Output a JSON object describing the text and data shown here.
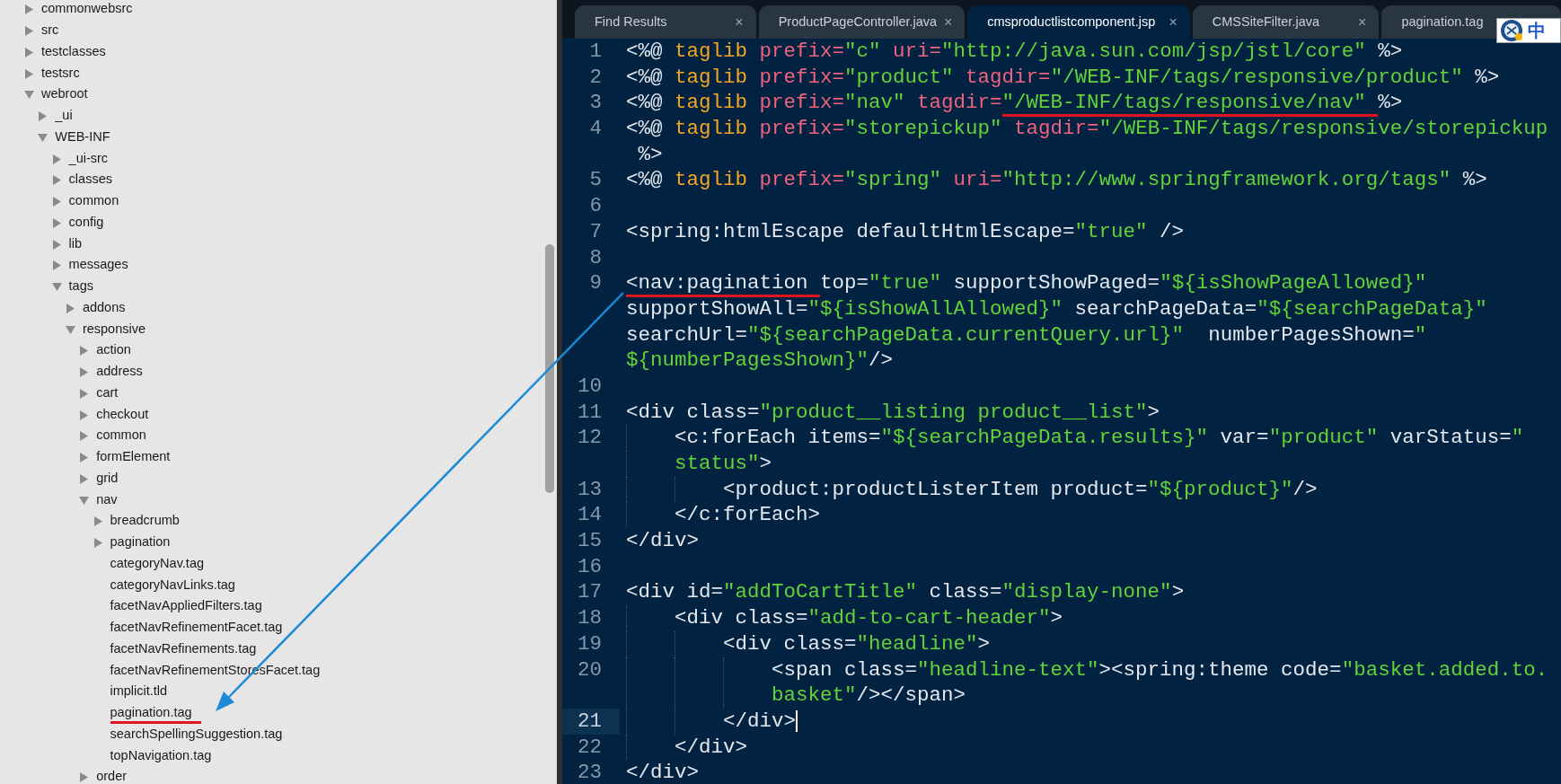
{
  "tree": [
    {
      "label": "commonwebsrc",
      "kind": "folder",
      "expanded": false,
      "underlined": false
    },
    {
      "label": "src",
      "kind": "folder",
      "expanded": false,
      "underlined": false
    },
    {
      "label": "testclasses",
      "kind": "folder",
      "expanded": false,
      "underlined": false
    },
    {
      "label": "testsrc",
      "kind": "folder",
      "expanded": false,
      "underlined": false
    },
    {
      "label": "webroot",
      "kind": "folder",
      "expanded": true,
      "underlined": false,
      "children": [
        {
          "label": "_ui",
          "kind": "folder",
          "expanded": false,
          "underlined": false
        },
        {
          "label": "WEB-INF",
          "kind": "folder",
          "expanded": true,
          "underlined": false,
          "children": [
            {
              "label": "_ui-src",
              "kind": "folder",
              "expanded": false,
              "underlined": false
            },
            {
              "label": "classes",
              "kind": "folder",
              "expanded": false,
              "underlined": false
            },
            {
              "label": "common",
              "kind": "folder",
              "expanded": false,
              "underlined": false
            },
            {
              "label": "config",
              "kind": "folder",
              "expanded": false,
              "underlined": false
            },
            {
              "label": "lib",
              "kind": "folder",
              "expanded": false,
              "underlined": false
            },
            {
              "label": "messages",
              "kind": "folder",
              "expanded": false,
              "underlined": false
            },
            {
              "label": "tags",
              "kind": "folder",
              "expanded": true,
              "underlined": false,
              "children": [
                {
                  "label": "addons",
                  "kind": "folder",
                  "expanded": false,
                  "underlined": false
                },
                {
                  "label": "responsive",
                  "kind": "folder",
                  "expanded": true,
                  "underlined": false,
                  "children": [
                    {
                      "label": "action",
                      "kind": "folder",
                      "expanded": false,
                      "underlined": false
                    },
                    {
                      "label": "address",
                      "kind": "folder",
                      "expanded": false,
                      "underlined": false
                    },
                    {
                      "label": "cart",
                      "kind": "folder",
                      "expanded": false,
                      "underlined": false
                    },
                    {
                      "label": "checkout",
                      "kind": "folder",
                      "expanded": false,
                      "underlined": false
                    },
                    {
                      "label": "common",
                      "kind": "folder",
                      "expanded": false,
                      "underlined": false
                    },
                    {
                      "label": "formElement",
                      "kind": "folder",
                      "expanded": false,
                      "underlined": false
                    },
                    {
                      "label": "grid",
                      "kind": "folder",
                      "expanded": false,
                      "underlined": false
                    },
                    {
                      "label": "nav",
                      "kind": "folder",
                      "expanded": true,
                      "underlined": false,
                      "children": [
                        {
                          "label": "breadcrumb",
                          "kind": "folder",
                          "expanded": false,
                          "underlined": false
                        },
                        {
                          "label": "pagination",
                          "kind": "folder",
                          "expanded": false,
                          "underlined": false
                        },
                        {
                          "label": "categoryNav.tag",
                          "kind": "file",
                          "underlined": false
                        },
                        {
                          "label": "categoryNavLinks.tag",
                          "kind": "file",
                          "underlined": false
                        },
                        {
                          "label": "facetNavAppliedFilters.tag",
                          "kind": "file",
                          "underlined": false
                        },
                        {
                          "label": "facetNavRefinementFacet.tag",
                          "kind": "file",
                          "underlined": false
                        },
                        {
                          "label": "facetNavRefinements.tag",
                          "kind": "file",
                          "underlined": false
                        },
                        {
                          "label": "facetNavRefinementStoresFacet.tag",
                          "kind": "file",
                          "underlined": false
                        },
                        {
                          "label": "implicit.tld",
                          "kind": "file",
                          "underlined": false
                        },
                        {
                          "label": "pagination.tag",
                          "kind": "file",
                          "underlined": true
                        },
                        {
                          "label": "searchSpellingSuggestion.tag",
                          "kind": "file",
                          "underlined": false
                        },
                        {
                          "label": "topNavigation.tag",
                          "kind": "file",
                          "underlined": false
                        }
                      ]
                    },
                    {
                      "label": "order",
                      "kind": "folder",
                      "expanded": false,
                      "underlined": false
                    }
                  ]
                }
              ]
            }
          ]
        }
      ]
    }
  ],
  "tabs": [
    {
      "label": "Find Results",
      "selected": false,
      "close": "×"
    },
    {
      "label": "ProductPageController.java",
      "selected": false,
      "close": "×"
    },
    {
      "label": "cmsproductlistcomponent.jsp",
      "selected": true,
      "close": "×"
    },
    {
      "label": "CMSSiteFilter.java",
      "selected": false,
      "close": "×"
    },
    {
      "label": "pagination.tag",
      "selected": false
    }
  ],
  "ime_indicator": {
    "label": "中"
  },
  "code_lines": [
    {
      "number": "1",
      "current": false,
      "rows": [
        {
          "tokens": [
            {
              "kind": "plain",
              "text": "<%@ ",
              "underlined": false
            },
            {
              "kind": "keyword",
              "text": "taglib",
              "underlined": false
            },
            {
              "kind": "attr",
              "text": " prefix=",
              "underlined": false
            },
            {
              "kind": "string",
              "text": "\"c\"",
              "underlined": false
            },
            {
              "kind": "attr",
              "text": " uri=",
              "underlined": false
            },
            {
              "kind": "string",
              "text": "\"http://java.sun.com/jsp/jstl/core\"",
              "underlined": false
            },
            {
              "kind": "plain",
              "text": " %>",
              "underlined": false
            }
          ]
        }
      ]
    },
    {
      "number": "2",
      "current": false,
      "rows": [
        {
          "tokens": [
            {
              "kind": "plain",
              "text": "<%@ ",
              "underlined": false
            },
            {
              "kind": "keyword",
              "text": "taglib",
              "underlined": false
            },
            {
              "kind": "attr",
              "text": " prefix=",
              "underlined": false
            },
            {
              "kind": "string",
              "text": "\"product\"",
              "underlined": false
            },
            {
              "kind": "attr",
              "text": " tagdir=",
              "underlined": false
            },
            {
              "kind": "string",
              "text": "\"/WEB-INF/tags/responsive/product\"",
              "underlined": false
            },
            {
              "kind": "plain",
              "text": " %>",
              "underlined": false
            }
          ]
        }
      ]
    },
    {
      "number": "3",
      "current": false,
      "rows": [
        {
          "tokens": [
            {
              "kind": "plain",
              "text": "<%@ ",
              "underlined": false
            },
            {
              "kind": "keyword",
              "text": "taglib",
              "underlined": false
            },
            {
              "kind": "attr",
              "text": " prefix=",
              "underlined": false
            },
            {
              "kind": "string",
              "text": "\"nav\"",
              "underlined": false
            },
            {
              "kind": "attr",
              "text": " tagdir=",
              "underlined": false
            },
            {
              "kind": "string",
              "text": "\"/WEB-INF/tags/responsive/nav\" ",
              "underlined": true
            },
            {
              "kind": "plain",
              "text": "%>",
              "underlined": false
            }
          ]
        }
      ]
    },
    {
      "number": "4",
      "current": false,
      "rows": [
        {
          "tokens": [
            {
              "kind": "plain",
              "text": "<%@ ",
              "underlined": false
            },
            {
              "kind": "keyword",
              "text": "taglib",
              "underlined": false
            },
            {
              "kind": "attr",
              "text": " prefix=",
              "underlined": false
            },
            {
              "kind": "string",
              "text": "\"storepickup\"",
              "underlined": false
            },
            {
              "kind": "attr",
              "text": " tagdir=",
              "underlined": false
            },
            {
              "kind": "string",
              "text": "\"/WEB-INF/tags/responsive/storepickup",
              "underlined": false
            }
          ]
        },
        {
          "tokens": [
            {
              "kind": "plain",
              "text": " %>",
              "underlined": false
            }
          ]
        }
      ]
    },
    {
      "number": "5",
      "current": false,
      "rows": [
        {
          "tokens": [
            {
              "kind": "plain",
              "text": "<%@ ",
              "underlined": false
            },
            {
              "kind": "keyword",
              "text": "taglib",
              "underlined": false
            },
            {
              "kind": "attr",
              "text": " prefix=",
              "underlined": false
            },
            {
              "kind": "string",
              "text": "\"spring\"",
              "underlined": false
            },
            {
              "kind": "attr",
              "text": " uri=",
              "underlined": false
            },
            {
              "kind": "string",
              "text": "\"http://www.springframework.org/tags\"",
              "underlined": false
            },
            {
              "kind": "plain",
              "text": " %>",
              "underlined": false
            }
          ]
        }
      ]
    },
    {
      "number": "6",
      "current": false
    },
    {
      "number": "7",
      "current": false,
      "rows": [
        {
          "tokens": [
            {
              "kind": "plain",
              "text": "<spring:htmlEscape defaultHtmlEscape=",
              "underlined": false
            },
            {
              "kind": "string",
              "text": "\"true\"",
              "underlined": false
            },
            {
              "kind": "plain",
              "text": " />",
              "underlined": false
            }
          ]
        }
      ]
    },
    {
      "number": "8",
      "current": false
    },
    {
      "number": "9",
      "current": false,
      "rows": [
        {
          "tokens": [
            {
              "kind": "plain",
              "text": "<nav:pagination ",
              "underlined": true
            },
            {
              "kind": "plain",
              "text": "top=",
              "underlined": false
            },
            {
              "kind": "string",
              "text": "\"true\"",
              "underlined": false
            },
            {
              "kind": "plain",
              "text": " supportShowPaged=",
              "underlined": false
            },
            {
              "kind": "string",
              "text": "\"${isShowPageAllowed}\"",
              "underlined": false
            }
          ]
        },
        {
          "tokens": [
            {
              "kind": "plain",
              "text": "supportShowAll=",
              "underlined": false
            },
            {
              "kind": "string",
              "text": "\"${isShowAllAllowed}\"",
              "underlined": false
            },
            {
              "kind": "plain",
              "text": " searchPageData=",
              "underlined": false
            },
            {
              "kind": "string",
              "text": "\"${searchPageData}\"",
              "underlined": false
            }
          ]
        },
        {
          "tokens": [
            {
              "kind": "plain",
              "text": "searchUrl=",
              "underlined": false
            },
            {
              "kind": "string",
              "text": "\"${searchPageData.currentQuery.url}\"",
              "underlined": false
            },
            {
              "kind": "plain",
              "text": "  numberPagesShown=",
              "underlined": false
            },
            {
              "kind": "string",
              "text": "\"",
              "underlined": false
            }
          ]
        },
        {
          "tokens": [
            {
              "kind": "string",
              "text": "${numberPagesShown}\"",
              "underlined": false
            },
            {
              "kind": "plain",
              "text": "/>",
              "underlined": false
            }
          ]
        }
      ]
    },
    {
      "number": "10",
      "current": false
    },
    {
      "number": "11",
      "current": false,
      "rows": [
        {
          "tokens": [
            {
              "kind": "plain",
              "text": "<div class=",
              "underlined": false
            },
            {
              "kind": "string",
              "text": "\"product__listing product__list\"",
              "underlined": false
            },
            {
              "kind": "plain",
              "text": ">",
              "underlined": false
            }
          ]
        }
      ],
      "children": [
        {
          "number": "12",
          "current": false,
          "rows": [
            {
              "tokens": [
                {
                  "kind": "plain",
                  "text": "<c:forEach items=",
                  "underlined": false
                },
                {
                  "kind": "string",
                  "text": "\"${searchPageData.results}\"",
                  "underlined": false
                },
                {
                  "kind": "plain",
                  "text": " var=",
                  "underlined": false
                },
                {
                  "kind": "string",
                  "text": "\"product\"",
                  "underlined": false
                },
                {
                  "kind": "plain",
                  "text": " varStatus=",
                  "underlined": false
                },
                {
                  "kind": "string",
                  "text": "\"",
                  "underlined": false
                }
              ]
            },
            {
              "tokens": [
                {
                  "kind": "string",
                  "text": "status\"",
                  "underlined": false
                },
                {
                  "kind": "plain",
                  "text": ">",
                  "underlined": false
                }
              ]
            }
          ],
          "children": [
            {
              "number": "13",
              "current": false,
              "rows": [
                {
                  "tokens": [
                    {
                      "kind": "plain",
                      "text": "<product:productListerItem product=",
                      "underlined": false
                    },
                    {
                      "kind": "string",
                      "text": "\"${product}\"",
                      "underlined": false
                    },
                    {
                      "kind": "plain",
                      "text": "/>",
                      "underlined": false
                    }
                  ]
                }
              ]
            }
          ]
        },
        {
          "number": "14",
          "current": false,
          "rows": [
            {
              "tokens": [
                {
                  "kind": "plain",
                  "text": "</c:forEach>",
                  "underlined": false
                }
              ]
            }
          ]
        }
      ]
    },
    {
      "number": "15",
      "current": false,
      "rows": [
        {
          "tokens": [
            {
              "kind": "plain",
              "text": "</div>",
              "underlined": false
            }
          ]
        }
      ]
    },
    {
      "number": "16",
      "current": false
    },
    {
      "number": "17",
      "current": false,
      "rows": [
        {
          "tokens": [
            {
              "kind": "plain",
              "text": "<div id=",
              "underlined": false
            },
            {
              "kind": "string",
              "text": "\"addToCartTitle\"",
              "underlined": false
            },
            {
              "kind": "plain",
              "text": " class=",
              "underlined": false
            },
            {
              "kind": "string",
              "text": "\"display-none\"",
              "underlined": false
            },
            {
              "kind": "plain",
              "text": ">",
              "underlined": false
            }
          ]
        }
      ],
      "children": [
        {
          "number": "18",
          "current": false,
          "rows": [
            {
              "tokens": [
                {
                  "kind": "plain",
                  "text": "<div class=",
                  "underlined": false
                },
                {
                  "kind": "string",
                  "text": "\"add-to-cart-header\"",
                  "underlined": false
                },
                {
                  "kind": "plain",
                  "text": ">",
                  "underlined": false
                }
              ]
            }
          ],
          "children": [
            {
              "number": "19",
              "current": false,
              "rows": [
                {
                  "tokens": [
                    {
                      "kind": "plain",
                      "text": "<div class=",
                      "underlined": false
                    },
                    {
                      "kind": "string",
                      "text": "\"headline\"",
                      "underlined": false
                    },
                    {
                      "kind": "plain",
                      "text": ">",
                      "underlined": false
                    }
                  ]
                }
              ],
              "children": [
                {
                  "number": "20",
                  "current": false,
                  "rows": [
                    {
                      "tokens": [
                        {
                          "kind": "plain",
                          "text": "<span class=",
                          "underlined": false
                        },
                        {
                          "kind": "string",
                          "text": "\"headline-text\"",
                          "underlined": false
                        },
                        {
                          "kind": "plain",
                          "text": "><spring:theme code=",
                          "underlined": false
                        },
                        {
                          "kind": "string",
                          "text": "\"basket.added.to.",
                          "underlined": false
                        }
                      ]
                    },
                    {
                      "tokens": [
                        {
                          "kind": "string",
                          "text": "basket\"",
                          "underlined": false
                        },
                        {
                          "kind": "plain",
                          "text": "/></span>",
                          "underlined": false
                        }
                      ]
                    }
                  ]
                }
              ]
            },
            {
              "number": "21",
              "current": true,
              "rows": [
                {
                  "tokens": [
                    {
                      "kind": "plain",
                      "text": "</div>",
                      "underlined": false
                    }
                  ]
                }
              ]
            }
          ]
        },
        {
          "number": "22",
          "current": false,
          "rows": [
            {
              "tokens": [
                {
                  "kind": "plain",
                  "text": "</div>",
                  "underlined": false
                }
              ]
            }
          ]
        }
      ]
    },
    {
      "number": "23",
      "current": false,
      "rows": [
        {
          "tokens": [
            {
              "kind": "plain",
              "text": "</div>",
              "underlined": false
            }
          ]
        }
      ]
    }
  ]
}
